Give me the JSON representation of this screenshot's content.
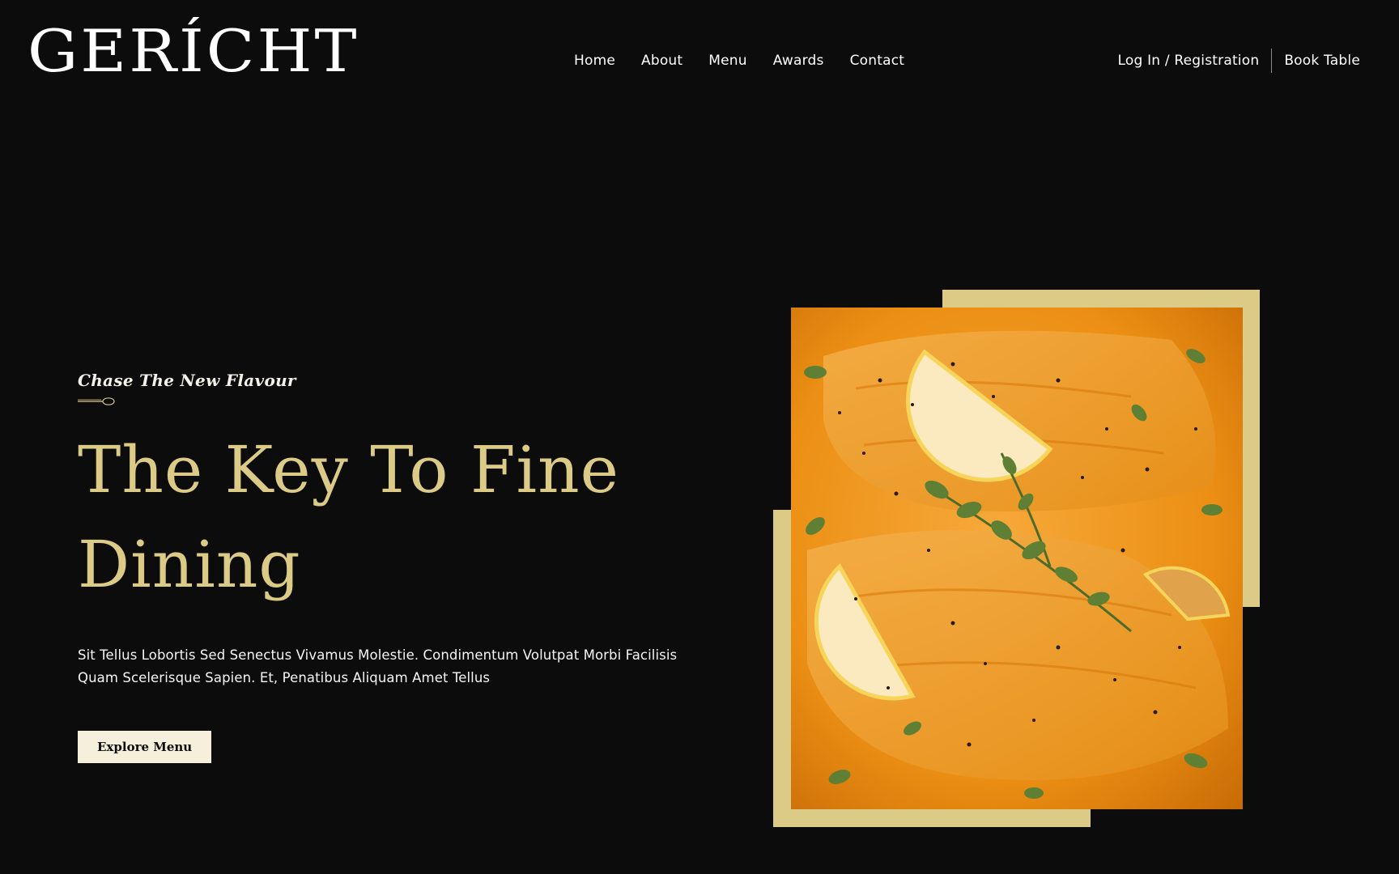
{
  "brand": {
    "logo_text": "GERÍCHT"
  },
  "nav": {
    "items": [
      {
        "label": "Home"
      },
      {
        "label": "About"
      },
      {
        "label": "Menu"
      },
      {
        "label": "Awards"
      },
      {
        "label": "Contact"
      }
    ]
  },
  "auth": {
    "login_label": "Log In / Registration",
    "book_label": "Book Table"
  },
  "hero": {
    "subtitle": "Chase The New Flavour",
    "headline_line1": "The Key To Fine",
    "headline_line2": "Dining",
    "description_line1": "Sit Tellus Lobortis Sed Senectus Vivamus Molestie. Condimentum Volutpat Morbi Facilisis",
    "description_line2": "Quam Scelerisque Sapien. Et, Penatibus Aliquam Amet Tellus",
    "cta_label": "Explore Menu"
  },
  "colors": {
    "background": "#0c0c0c",
    "accent_gold": "#dcca87",
    "button_bg": "#f5efdb",
    "text": "#ffffff"
  },
  "icons": {
    "divider": "spoon-icon"
  }
}
